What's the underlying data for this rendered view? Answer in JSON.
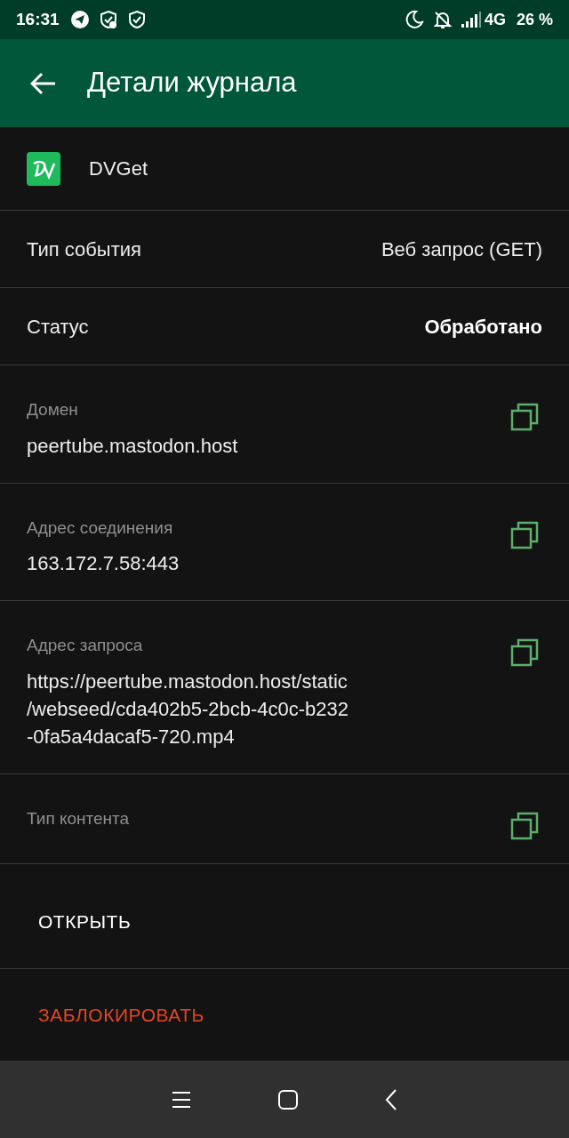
{
  "status_bar": {
    "time": "16:31",
    "network": "4G",
    "battery": "26 %"
  },
  "app_bar": {
    "title": "Детали журнала"
  },
  "app": {
    "name": "DVGet"
  },
  "pairs": [
    {
      "label": "Тип события",
      "value": "Веб запрос (GET)",
      "bold": false
    },
    {
      "label": "Статус",
      "value": "Обработано",
      "bold": true
    }
  ],
  "fields": [
    {
      "label": "Домен",
      "value": "peertube.mastodon.host"
    },
    {
      "label": "Адрес соединения",
      "value": "163.172.7.58:443"
    },
    {
      "label": "Адрес запроса",
      "value": "https://peertube.mastodon.host/static\n/webseed/cda402b5-2bcb-4c0c-b232\n-0fa5a4dacaf5-720.mp4"
    },
    {
      "label": "Тип контента"
    }
  ],
  "actions": [
    {
      "label": "ОТКРЫТЬ",
      "kind": "normal"
    },
    {
      "label": "ЗАБЛОКИРОВАТЬ",
      "kind": "danger"
    }
  ]
}
